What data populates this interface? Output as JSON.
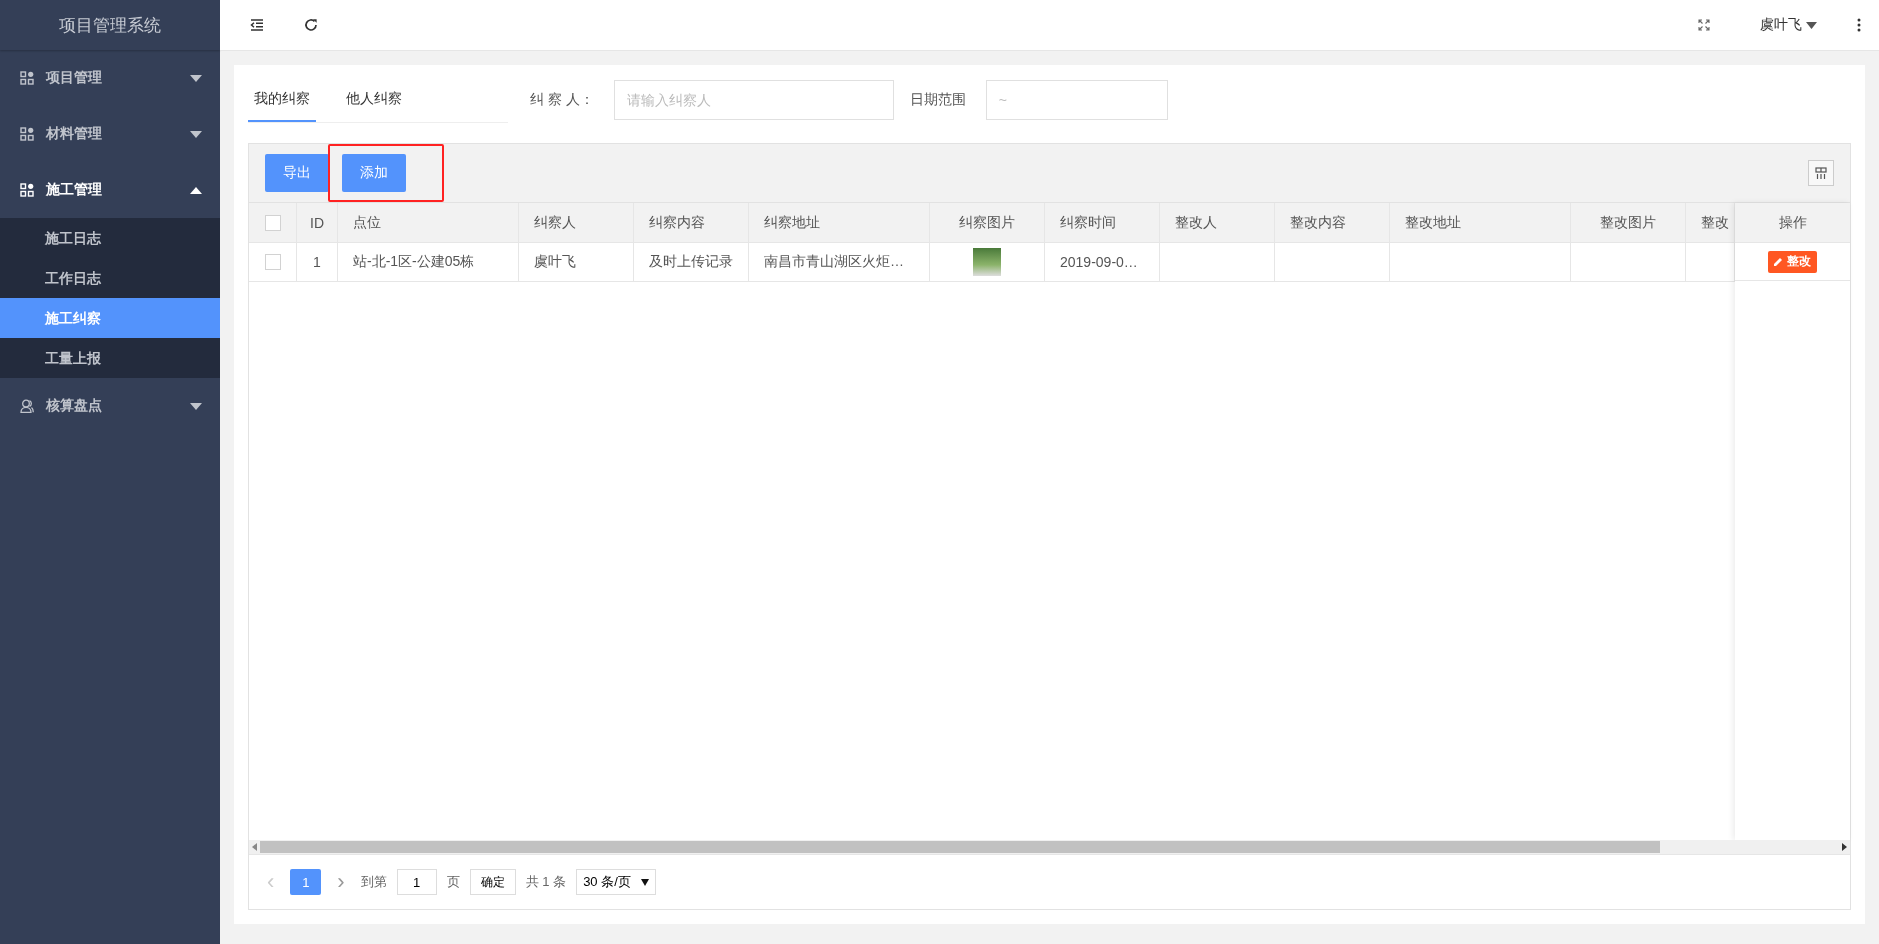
{
  "sidebar": {
    "title": "项目管理系统",
    "items": [
      {
        "label": "项目管理",
        "kind": "modules",
        "expanded": false
      },
      {
        "label": "材料管理",
        "kind": "modules",
        "expanded": false
      },
      {
        "label": "施工管理",
        "kind": "modules",
        "expanded": true,
        "children": [
          {
            "label": "施工日志",
            "selected": false
          },
          {
            "label": "工作日志",
            "selected": false
          },
          {
            "label": "施工纠察",
            "selected": true
          },
          {
            "label": "工量上报",
            "selected": false
          }
        ]
      },
      {
        "label": "核算盘点",
        "kind": "person",
        "expanded": false
      }
    ]
  },
  "header": {
    "user": "虞叶飞"
  },
  "tabs": [
    {
      "label": "我的纠察",
      "selected": true
    },
    {
      "label": "他人纠察",
      "selected": false
    }
  ],
  "filters": [
    {
      "label": "纠 察 人：",
      "placeholder": "请输入纠察人"
    },
    {
      "label": "日期范围",
      "placeholder": "~"
    }
  ],
  "toolbar": {
    "buttons": [
      {
        "label": "导出",
        "highlighted": false
      },
      {
        "label": "添加",
        "highlighted": true
      }
    ]
  },
  "table": {
    "columns": [
      {
        "label": "ID",
        "kind": "center"
      },
      {
        "label": "点位",
        "kind": "wide"
      },
      {
        "label": "纠察人",
        "kind": "normal"
      },
      {
        "label": "纠察内容",
        "kind": "normal"
      },
      {
        "label": "纠察地址",
        "kind": "wide"
      },
      {
        "label": "纠察图片",
        "kind": "normalc"
      },
      {
        "label": "纠察时间",
        "kind": "normal"
      },
      {
        "label": "整改人",
        "kind": "normal"
      },
      {
        "label": "整改内容",
        "kind": "normal"
      },
      {
        "label": "整改地址",
        "kind": "wide"
      },
      {
        "label": "整改图片",
        "kind": "normalc"
      },
      {
        "label": "整改",
        "kind": "rest"
      }
    ],
    "action_column": "操作",
    "all_checked": false,
    "rows": [
      {
        "checked": false,
        "cells": [
          {
            "kind": "text",
            "text": "1"
          },
          {
            "kind": "text",
            "text": "站-北-1区-公建05栋"
          },
          {
            "kind": "text",
            "text": "虞叶飞"
          },
          {
            "kind": "text",
            "text": "及时上传记录"
          },
          {
            "kind": "text",
            "text": "南昌市青山湖区火炬…"
          },
          {
            "kind": "photo"
          },
          {
            "kind": "text",
            "text": "2019-09-0…"
          },
          {
            "kind": "empty"
          },
          {
            "kind": "empty"
          },
          {
            "kind": "empty"
          },
          {
            "kind": "empty"
          },
          {
            "kind": "empty"
          }
        ],
        "action": "整改"
      }
    ]
  },
  "pagination": {
    "prev": "‹",
    "page": "1",
    "next": "›",
    "goto_label": "到第",
    "goto_value": "1",
    "page_unit": "页",
    "confirm": "确定",
    "total": "共 1 条",
    "page_size": "30 条/页"
  }
}
